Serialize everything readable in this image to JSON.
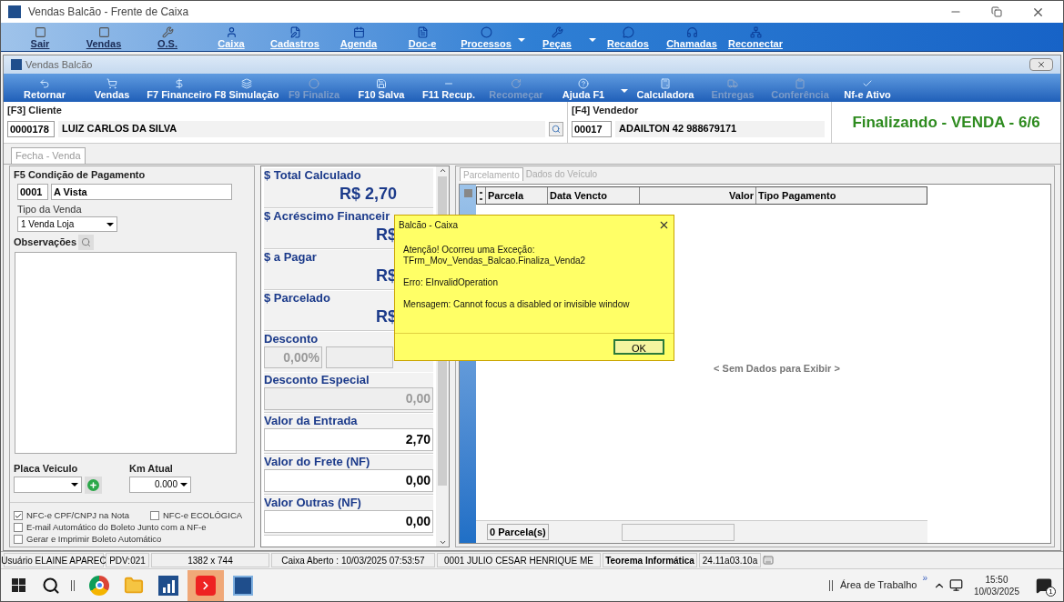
{
  "window": {
    "title": "Vendas Balcão - Frente de Caixa"
  },
  "main_toolbar": [
    {
      "label": "Sair",
      "dropdown": false
    },
    {
      "label": "Vendas",
      "dropdown": false
    },
    {
      "label": "O.S.",
      "dropdown": false
    },
    {
      "label": "Caixa",
      "dropdown": false
    },
    {
      "label": "Cadastros",
      "dropdown": false
    },
    {
      "label": "Agenda",
      "dropdown": false
    },
    {
      "label": "Doc-e",
      "dropdown": false
    },
    {
      "label": "Processos",
      "dropdown": true
    },
    {
      "label": "Peças",
      "dropdown": true
    },
    {
      "label": "Recados",
      "dropdown": false
    },
    {
      "label": "Chamadas",
      "dropdown": false
    },
    {
      "label": "Reconectar",
      "dropdown": false
    }
  ],
  "inner_window": {
    "title": "Vendas Balcão"
  },
  "sub_toolbar": [
    {
      "label": "Retornar",
      "disabled": false,
      "dropdown": false
    },
    {
      "label": "Vendas",
      "disabled": false,
      "dropdown": false
    },
    {
      "label": "F7 Financeiro",
      "disabled": false,
      "dropdown": false
    },
    {
      "label": "F8 Simulação",
      "disabled": false,
      "dropdown": false
    },
    {
      "label": "F9 Finaliza",
      "disabled": true,
      "dropdown": false
    },
    {
      "label": "F10 Salva",
      "disabled": false,
      "dropdown": false
    },
    {
      "label": "F11 Recup.",
      "disabled": false,
      "dropdown": false
    },
    {
      "label": "Recomeçar",
      "disabled": true,
      "dropdown": false
    },
    {
      "label": "Ajuda F1",
      "disabled": false,
      "dropdown": true
    },
    {
      "label": "Calculadora",
      "disabled": false,
      "dropdown": false
    },
    {
      "label": "Entregas",
      "disabled": true,
      "dropdown": false
    },
    {
      "label": "Conferência",
      "disabled": true,
      "dropdown": false
    },
    {
      "label": "Nf-e Ativo",
      "disabled": false,
      "dropdown": false
    }
  ],
  "cliente": {
    "label": "[F3] Cliente",
    "code": "0000178",
    "name": "LUIZ CARLOS DA SILVA"
  },
  "vendedor": {
    "label": "[F4] Vendedor",
    "code": "00017",
    "name": "ADAILTON 42 988679171"
  },
  "status_title": "Finalizando - VENDA - 6/6",
  "main_tab": {
    "label": "Fecha - Venda",
    "selected": true
  },
  "pagamento": {
    "label": "F5 Condição de Pagamento",
    "code": "0001",
    "name": "A Vista",
    "tipo_label": "Tipo da Venda",
    "tipo_value": "1 Venda Loja",
    "obs_label": "Observações",
    "placa_label": "Placa Veiculo",
    "km_label": "Km Atual",
    "km_value": "0.000"
  },
  "checkboxes": [
    {
      "label": "NFC-e CPF/CNPJ na Nota",
      "checked": true
    },
    {
      "label": "NFC-e ECOLÓGICA",
      "checked": false
    },
    {
      "label": "E-mail Automático do Boleto Junto com a NF-e",
      "checked": false
    },
    {
      "label": "Gerar e Imprimir Boleto Automático",
      "checked": false
    }
  ],
  "totals": [
    {
      "kind": "total",
      "label": "$ Total Calculado",
      "value": "R$ 2,70"
    },
    {
      "kind": "total",
      "label": "$ Acréscimo Financeir",
      "value": "R$"
    },
    {
      "kind": "total",
      "label": "$ a Pagar",
      "value": "R$"
    },
    {
      "kind": "total",
      "label": "$ Parcelado",
      "value": "R$"
    },
    {
      "kind": "percent",
      "label": "Desconto",
      "value": "0,00%",
      "disabled": true
    },
    {
      "kind": "field",
      "label": "Desconto Especial",
      "value": "0,00",
      "disabled": true
    },
    {
      "kind": "field",
      "label": "Valor da Entrada",
      "value": "2,70",
      "disabled": false
    },
    {
      "kind": "field",
      "label": "Valor do Frete (NF)",
      "value": "0,00",
      "disabled": false
    },
    {
      "kind": "field",
      "label": "Valor Outras (NF)",
      "value": "0,00",
      "disabled": false
    }
  ],
  "right_tabs": [
    {
      "label": "Parcelamento",
      "selected": true
    },
    {
      "label": "Dados do Veículo",
      "selected": false
    }
  ],
  "grid": {
    "columns": [
      "Parcela",
      "Data Vencto",
      "Valor",
      "Tipo Pagamento"
    ],
    "empty_text": "< Sem Dados para Exibir >",
    "footer": "0 Parcela(s)"
  },
  "dialog": {
    "title": "Balcão - Caixa",
    "lines": [
      "Atenção! Ocorreu uma Exceção:",
      "TFrm_Mov_Vendas_Balcao.Finaliza_Venda2",
      "Erro: EInvalidOperation",
      "Mensagem: Cannot focus a disabled or invisible window"
    ],
    "button": "OK"
  },
  "status_bar": [
    {
      "text": "Usuário ELAINE APAREC",
      "bold": false
    },
    {
      "text": "PDV:021",
      "bold": false
    },
    {
      "text": "1382 x 744",
      "bold": false
    },
    {
      "text": "Caixa Aberto : 10/03/2025 07:53:57",
      "bold": false
    },
    {
      "text": "0001 JULIO CESAR HENRIQUE ME",
      "bold": false
    },
    {
      "text": "Teorema Informática",
      "bold": true
    },
    {
      "text": "24.11a03.10a",
      "bold": false
    }
  ],
  "taskbar": {
    "desktop_label": "Área de Trabalho",
    "chevron": "»",
    "time": "15:50",
    "date": "10/03/2025",
    "notification_count": "1"
  }
}
